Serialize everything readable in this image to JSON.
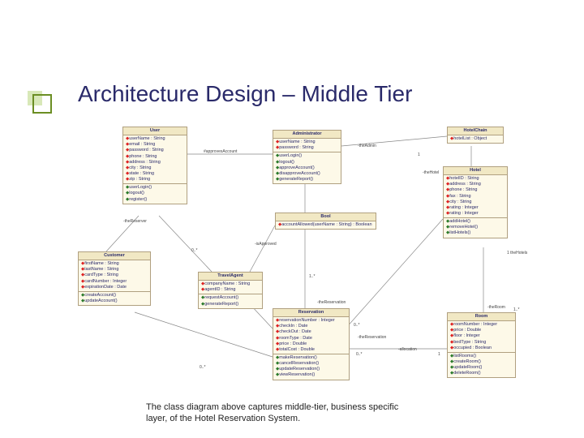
{
  "slide": {
    "title": "Architecture Design – Middle Tier",
    "caption": "The class diagram above captures middle-tier, business specific layer, of the Hotel Reservation System."
  },
  "classes": {
    "user": {
      "name": "User",
      "attrs": [
        "userName : String",
        "email : String",
        "password : String",
        "phone : String",
        "address : String",
        "city : String",
        "state : String",
        "zip : String"
      ],
      "ops": [
        "userLogin()",
        "logout()",
        "register()"
      ]
    },
    "admin": {
      "name": "Administrator",
      "attrs": [
        "userName : String",
        "password : String"
      ],
      "ops": [
        "userLogin()",
        "logout()",
        "approveAccount()",
        "disapproveAccount()",
        "generateReport()"
      ]
    },
    "hotelChain": {
      "name": "HotelChain",
      "attrs": [
        "hotelList : Object"
      ],
      "ops": []
    },
    "hotel": {
      "name": "Hotel",
      "attrs": [
        "hotelID : String",
        "address : String",
        "phone : String",
        "fax : String",
        "city : String",
        "rating : Integer",
        "rating : Integer"
      ],
      "ops": [
        "addHotel()",
        "removeHotel()",
        "listHotels()"
      ]
    },
    "bool": {
      "name": "Bool",
      "attrs": [
        "accountAllowed(userName : String) : Boolean"
      ],
      "ops": []
    },
    "customer": {
      "name": "Customer",
      "attrs": [
        "firstName : String",
        "lastName : String",
        "cardType : String",
        "cardNumber : Integer",
        "expirationDate : Date"
      ],
      "ops": [
        "createAccount()",
        "updateAccount()"
      ]
    },
    "travelAgent": {
      "name": "TravelAgent",
      "attrs": [
        "companyName : String",
        "agentID : String"
      ],
      "ops": [
        "requestAccount()",
        "generateReport()"
      ]
    },
    "reservation": {
      "name": "Reservation",
      "attrs": [
        "reservationNumber : Integer",
        "checkIn : Date",
        "checkOut : Date",
        "roomType : Date",
        "price : Double",
        "totalCost : Double"
      ],
      "ops": [
        "makeReservation()",
        "cancelReservation()",
        "updateReservation()",
        "viewReservation()"
      ]
    },
    "room": {
      "name": "Room",
      "attrs": [
        "roomNumber : Integer",
        "price : Double",
        "floor : Integer",
        "bedType : String",
        "occupied : Boolean"
      ],
      "ops": [
        "listRooms()",
        "createRoom()",
        "updateRoom()",
        "deleteRoom()"
      ]
    }
  },
  "assoc": {
    "approveAccount": "#approvesAccount",
    "theAdmin": "-theAdmin",
    "theHotel": "-theHotel",
    "theReserver": "-theReserver",
    "approved": "-isApproved",
    "theReservation_left": "-theReservation",
    "theReservation_right": "-theReservation",
    "allocation": "-allocation",
    "theRoom": "-theRoom",
    "theHotels": "1 theHotels",
    "mult_1star_a": "1..*",
    "mult_0star_a": "0..*",
    "mult_0star_b": "0..*",
    "mult_0star_c": "0..*",
    "mult_1_a": "1",
    "mult_1_b": "1",
    "mult_1star_b": "1..*",
    "mult_0star_d": "0..*"
  }
}
